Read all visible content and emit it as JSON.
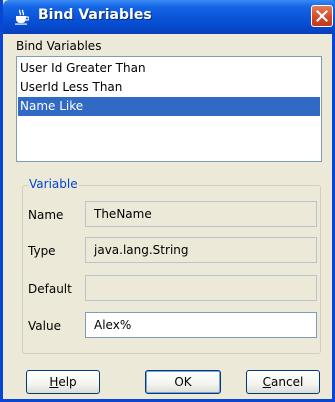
{
  "window": {
    "title": "Bind Variables",
    "icon": "coffee-cup-icon",
    "close_icon": "close-icon",
    "title_bar_color": "#0a53d8"
  },
  "bind_variables": {
    "label": "Bind Variables",
    "items": [
      "User Id Greater Than",
      "UserId Less Than",
      "Name Like"
    ],
    "selected": "Name Like",
    "selection_color": "#316ac5"
  },
  "variable": {
    "group_label": "Variable",
    "name": {
      "label": "Name",
      "value": "TheName"
    },
    "type": {
      "label": "Type",
      "value": "java.lang.String"
    },
    "default": {
      "label": "Default",
      "value": ""
    },
    "value": {
      "label": "Value",
      "value": "Alex%"
    }
  },
  "buttons": {
    "help": {
      "pre": "",
      "mnemonic": "H",
      "post": "elp"
    },
    "ok": "OK",
    "cancel": {
      "pre": "",
      "mnemonic": "C",
      "post": "ancel"
    }
  }
}
